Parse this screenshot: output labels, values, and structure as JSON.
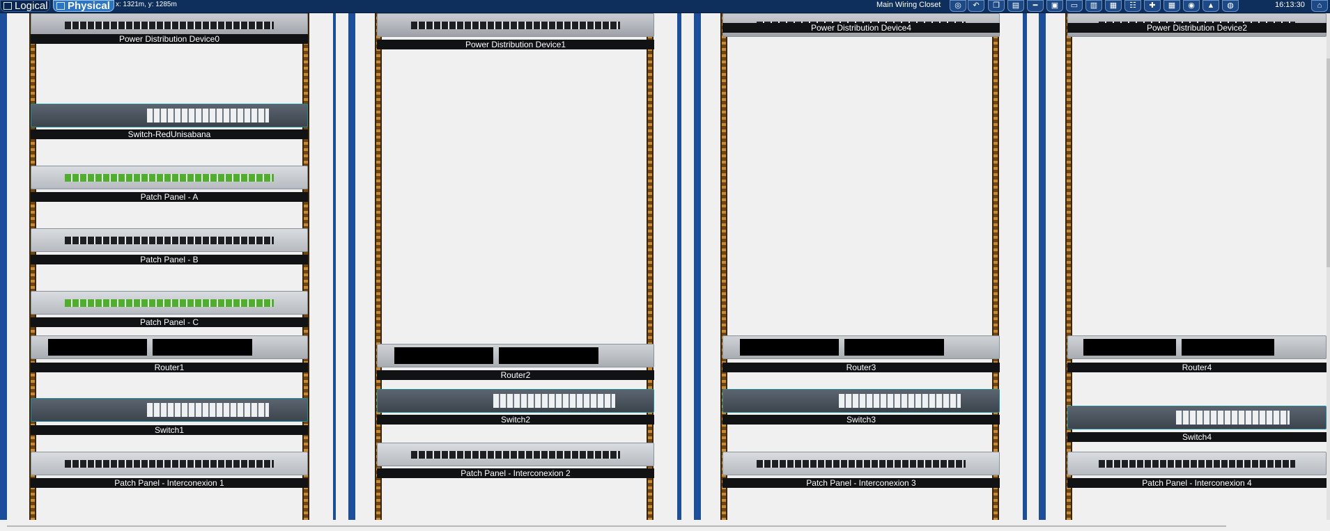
{
  "topbar": {
    "tabs": [
      {
        "label": "Logical",
        "active": false,
        "icon": "logical-view-icon"
      },
      {
        "label": "Physical",
        "active": true,
        "icon": "physical-view-icon"
      }
    ],
    "coordinates": "x: 1321m, y: 1285m",
    "location": "Main Wiring Closet",
    "clock": "16:13:30",
    "tools": [
      "navigation-icon",
      "back-icon",
      "move-object-icon",
      "new-rack-icon",
      "new-cable-icon",
      "new-device-icon",
      "new-table-icon",
      "new-shelf-icon",
      "new-cabinet-icon",
      "grid-icon",
      "move-icon",
      "layout-icon",
      "wireless-icon",
      "background-icon",
      "set-tiled-background-icon",
      "home-icon"
    ]
  },
  "racks": [
    {
      "devices": [
        {
          "type": "pdu",
          "label": "Power Distribution Device0"
        },
        {
          "type": "switch",
          "label": "Switch-RedUnisabana"
        },
        {
          "type": "patch",
          "label": "Patch Panel - A"
        },
        {
          "type": "patch",
          "label": "Patch Panel - B"
        },
        {
          "type": "patch",
          "label": "Patch Panel - C"
        },
        {
          "type": "router",
          "label": "Router1"
        },
        {
          "type": "switch",
          "label": "Switch1"
        },
        {
          "type": "patch",
          "label": "Patch Panel - Interconexion 1"
        }
      ]
    },
    {
      "devices": [
        {
          "type": "pdu",
          "label": "Power Distribution Device1"
        },
        {
          "type": "router",
          "label": "Router2"
        },
        {
          "type": "switch",
          "label": "Switch2"
        },
        {
          "type": "patch",
          "label": "Patch Panel - Interconexion 2"
        }
      ]
    },
    {
      "devices": [
        {
          "type": "pdu",
          "label": "Power Distribution Device4"
        },
        {
          "type": "router",
          "label": "Router3"
        },
        {
          "type": "switch",
          "label": "Switch3"
        },
        {
          "type": "patch",
          "label": "Patch Panel - Interconexion 3"
        }
      ]
    },
    {
      "devices": [
        {
          "type": "pdu",
          "label": "Power Distribution Device2"
        },
        {
          "type": "router",
          "label": "Router4"
        },
        {
          "type": "switch",
          "label": "Switch4"
        },
        {
          "type": "patch",
          "label": "Patch Panel - Interconexion 4"
        }
      ]
    }
  ]
}
